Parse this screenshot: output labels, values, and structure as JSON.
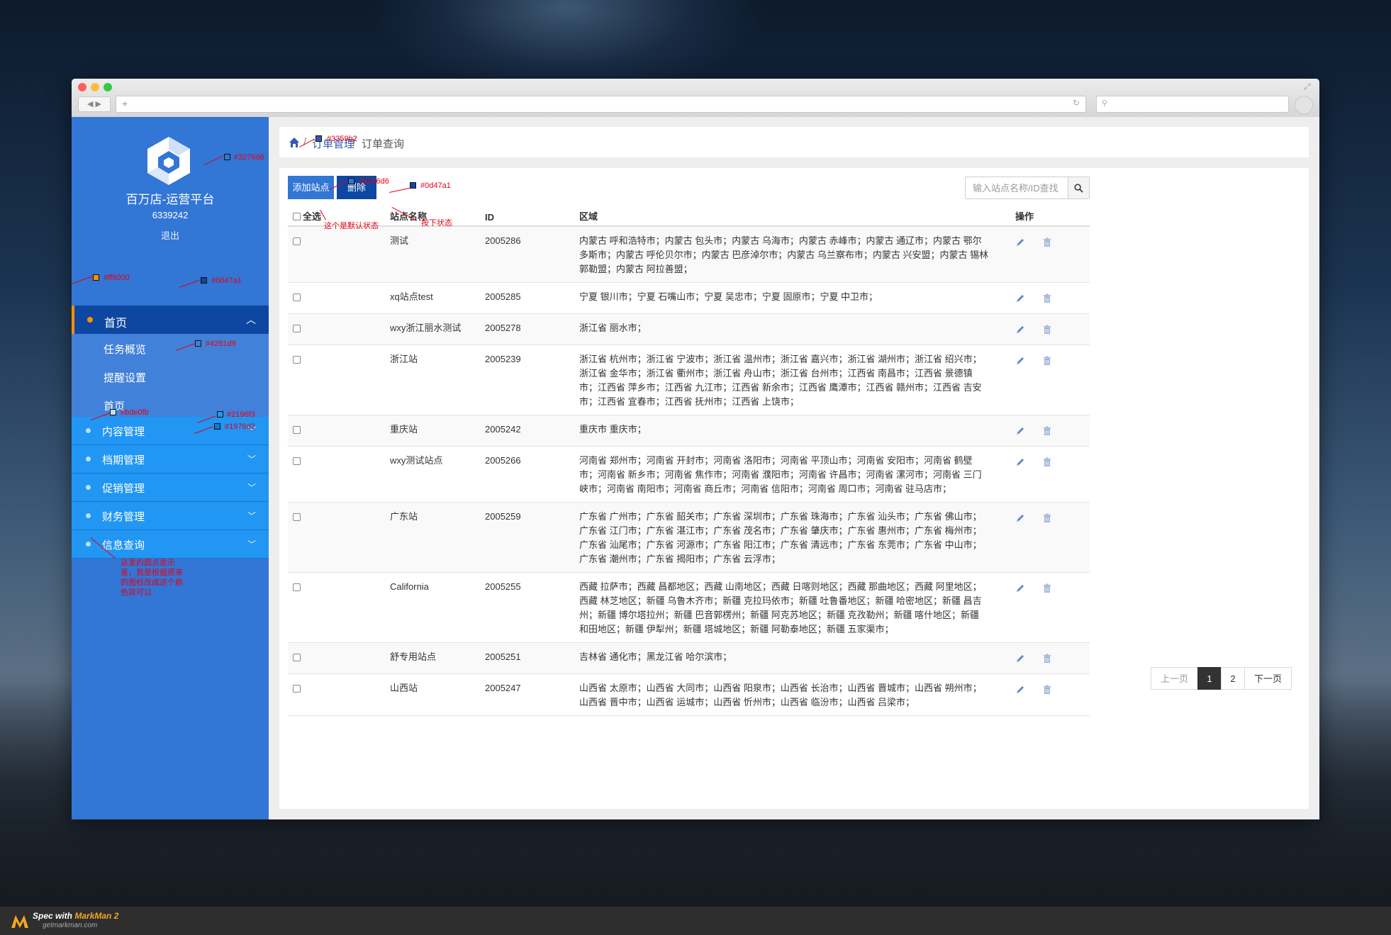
{
  "sidebar": {
    "brand": "百万店-运营平台",
    "user_id": "6339242",
    "logout": "退出",
    "active_item": "首页",
    "sub_items": [
      "任务概览",
      "提醒设置",
      "首页"
    ],
    "groups": [
      "内容管理",
      "档期管理",
      "促销管理",
      "财务管理",
      "信息查询"
    ]
  },
  "breadcrumb": {
    "sep": "/",
    "level1": "订单管理",
    "level2": "订单查询"
  },
  "toolbar": {
    "add_label": "添加站点",
    "delete_label": "删除",
    "search_placeholder": "输入站点名称/ID查找"
  },
  "table": {
    "headers": {
      "select_all": "全选",
      "name": "站点名称",
      "id": "ID",
      "region": "区域",
      "actions": "操作"
    },
    "rows": [
      {
        "name": "测试",
        "id": "2005286",
        "region": "内蒙古 呼和浩特市；内蒙古 包头市；内蒙古 乌海市；内蒙古 赤峰市；内蒙古 通辽市；内蒙古 鄂尔多斯市；内蒙古 呼伦贝尔市；内蒙古 巴彦淖尔市；内蒙古 乌兰察布市；内蒙古 兴安盟；内蒙古 锡林郭勒盟；内蒙古 阿拉善盟；"
      },
      {
        "name": "xq站点test",
        "id": "2005285",
        "region": "宁夏 银川市；宁夏 石嘴山市；宁夏 吴忠市；宁夏 固原市；宁夏 中卫市；"
      },
      {
        "name": "wxy浙江丽水测试",
        "id": "2005278",
        "region": "浙江省 丽水市；"
      },
      {
        "name": "浙江站",
        "id": "2005239",
        "region": "浙江省 杭州市；浙江省 宁波市；浙江省 温州市；浙江省 嘉兴市；浙江省 湖州市；浙江省 绍兴市；浙江省 金华市；浙江省 衢州市；浙江省 舟山市；浙江省 台州市；江西省 南昌市；江西省 景德镇市；江西省 萍乡市；江西省 九江市；江西省 新余市；江西省 鹰潭市；江西省 赣州市；江西省 吉安市；江西省 宜春市；江西省 抚州市；江西省 上饶市；"
      },
      {
        "name": "重庆站",
        "id": "2005242",
        "region": "重庆市 重庆市；"
      },
      {
        "name": "wxy测试站点",
        "id": "2005266",
        "region": "河南省 郑州市；河南省 开封市；河南省 洛阳市；河南省 平顶山市；河南省 安阳市；河南省 鹤壁市；河南省 新乡市；河南省 焦作市；河南省 濮阳市；河南省 许昌市；河南省 漯河市；河南省 三门峡市；河南省 南阳市；河南省 商丘市；河南省 信阳市；河南省 周口市；河南省 驻马店市；"
      },
      {
        "name": "广东站",
        "id": "2005259",
        "region": "广东省 广州市；广东省 韶关市；广东省 深圳市；广东省 珠海市；广东省 汕头市；广东省 佛山市；广东省 江门市；广东省 湛江市；广东省 茂名市；广东省 肇庆市；广东省 惠州市；广东省 梅州市；广东省 汕尾市；广东省 河源市；广东省 阳江市；广东省 清远市；广东省 东莞市；广东省 中山市；广东省 潮州市；广东省 揭阳市；广东省 云浮市；"
      },
      {
        "name": "California",
        "id": "2005255",
        "region": "西藏 拉萨市；西藏 昌都地区；西藏 山南地区；西藏 日喀则地区；西藏 那曲地区；西藏 阿里地区；西藏 林芝地区；新疆 乌鲁木齐市；新疆 克拉玛依市；新疆 吐鲁番地区；新疆 哈密地区；新疆 昌吉州；新疆 博尔塔拉州；新疆 巴音郭楞州；新疆 阿克苏地区；新疆 克孜勒州；新疆 喀什地区；新疆 和田地区；新疆 伊犁州；新疆 塔城地区；新疆 阿勒泰地区；新疆 五家渠市；"
      },
      {
        "name": "舒专用站点",
        "id": "2005251",
        "region": "吉林省 通化市；黑龙江省 哈尔滨市；"
      },
      {
        "name": "山西站",
        "id": "2005247",
        "region": "山西省 太原市；山西省 大同市；山西省 阳泉市；山西省 长治市；山西省 晋城市；山西省 朔州市；山西省 晋中市；山西省 运城市；山西省 忻州市；山西省 临汾市；山西省 吕梁市；"
      }
    ]
  },
  "pagination": {
    "prev": "上一页",
    "page1": "1",
    "page2": "2",
    "next": "下一页",
    "current": "1"
  },
  "annotations": {
    "logo_color": "#3276d6",
    "breadcrumb_color": "#3359b2",
    "add_btn_color": "#3276d6",
    "del_btn_color": "#0d47a1",
    "add_btn_note": "这个是默认状态",
    "del_btn_note": "按下状态",
    "active_bar_color": "#ff9000",
    "active_bg_color": "#0d47a1",
    "submenu_bg_color": "#4281d9",
    "bullet_color": "#bde0fb",
    "group_bg_color": "#2196f3",
    "group_border_color": "#1976d2",
    "sidebar_note": "这里的圆点是示意，我是根据原来的图标改成这个颜色就可以"
  },
  "footer": {
    "spec_prefix": "Spec with",
    "spec_brand": "MarkMan 2",
    "url": "getmarkman.com"
  }
}
